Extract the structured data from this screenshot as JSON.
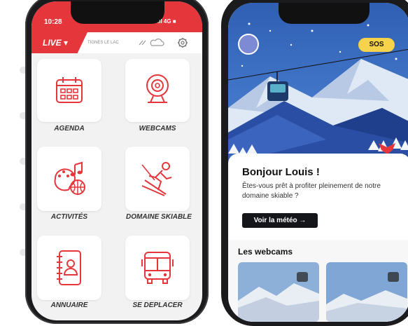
{
  "phone1": {
    "status": {
      "time": "10:28",
      "signal": ".ıl 4G ■"
    },
    "topbar": {
      "live_label": "LIVE ▾",
      "location": "TIGNES LE LAC"
    },
    "tiles": [
      {
        "label": "AGENDA",
        "icon": "calendar-icon"
      },
      {
        "label": "WEBCAMS",
        "icon": "webcam-icon"
      },
      {
        "label": "ACTIVITÉS",
        "icon": "activities-icon"
      },
      {
        "label": "DOMAINE SKIABLE",
        "icon": "skier-icon"
      },
      {
        "label": "ANNUAIRE",
        "icon": "contacts-book-icon"
      },
      {
        "label": "SE DEPLACER",
        "icon": "bus-icon"
      }
    ],
    "accent": "#e5373b"
  },
  "phone2": {
    "sos_label": "SOS",
    "greeting": "Bonjour Louis !",
    "description": "Êtes-vous prêt à profiter pleinement de notre domaine skiable ?",
    "weather_button": "Voir la météo →",
    "webcams_title": "Les webcams"
  }
}
